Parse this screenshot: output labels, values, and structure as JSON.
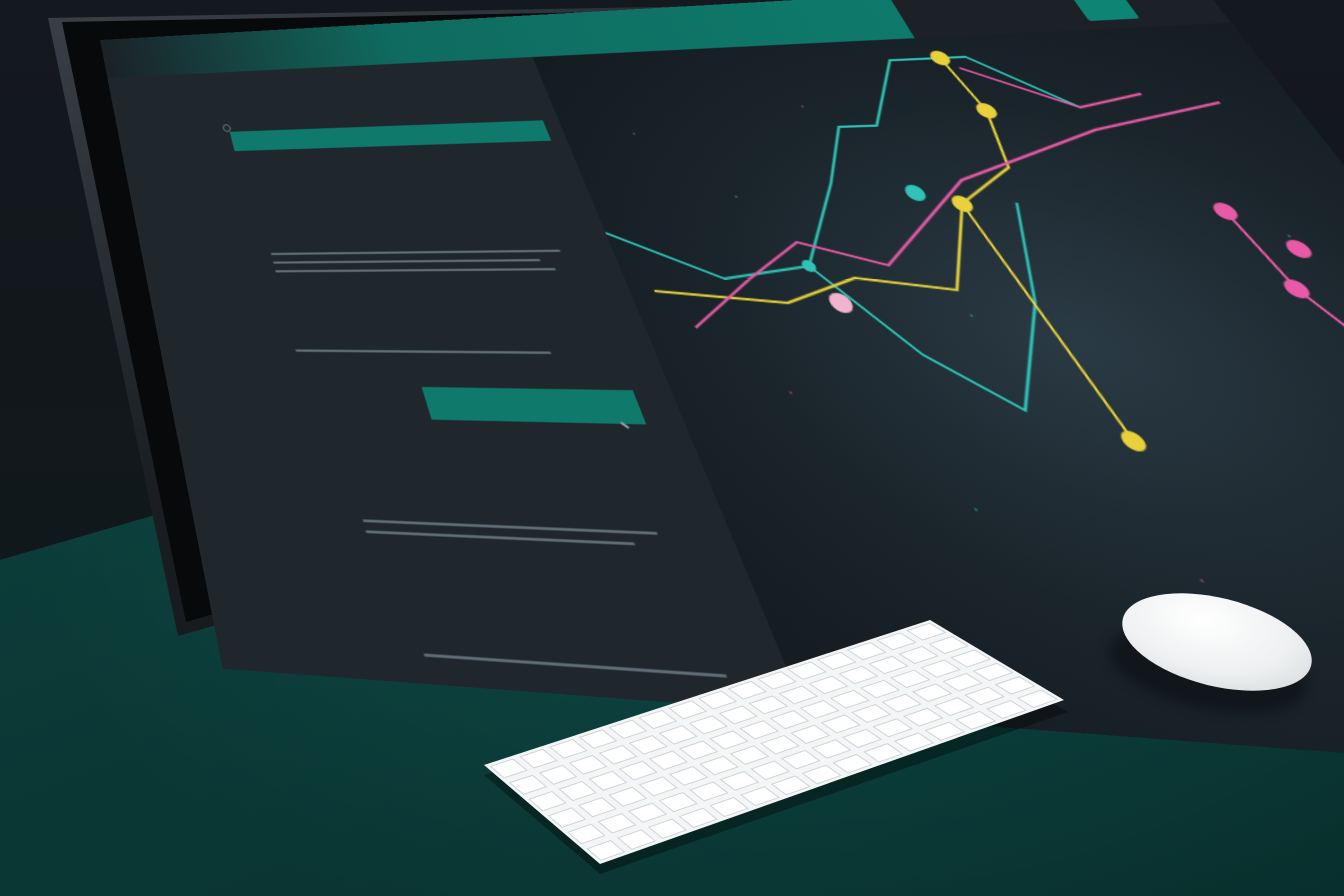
{
  "scene": {
    "wall_color": "#14191f",
    "desk_color": "#0f4e4a",
    "accent_color": "#0f7a6b"
  },
  "screen": {
    "brand": "",
    "nav": [
      "",
      "",
      ""
    ],
    "nav_button": "",
    "hero_title": "",
    "hero_sub": "",
    "sections": [
      {
        "label": "",
        "headline": ""
      },
      {
        "label": "",
        "headline": ""
      },
      {
        "label": "",
        "headline": ""
      },
      {
        "label": "",
        "headline": ""
      }
    ],
    "cta_label": "",
    "chart_colors": {
      "teal": "#2ec4b6",
      "yellow": "#e8d13a",
      "pink": "#e85aa6"
    }
  },
  "devices": {
    "keyboard": "keyboard",
    "mouse": "mouse"
  }
}
